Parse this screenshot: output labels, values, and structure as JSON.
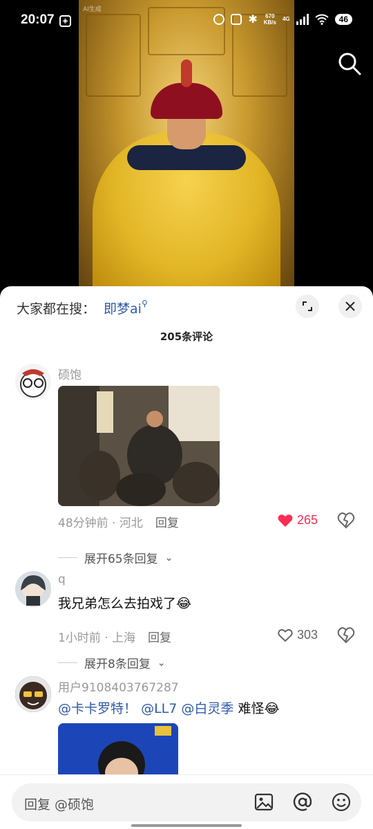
{
  "status_bar": {
    "time": "20:07",
    "ai_label": "AI生成",
    "net_speed_top": "670",
    "net_speed_bottom": "KB/s",
    "network_type": "4G",
    "battery": "46"
  },
  "sheet": {
    "search_prefix": "大家都在搜：",
    "search_term": "即梦ai",
    "comment_count": "205条评论"
  },
  "comments": [
    {
      "user": "硕饱",
      "time": "48分钟前 · 河北",
      "reply": "回复",
      "likes": "265",
      "liked": true,
      "expand": "展开65条回复"
    },
    {
      "user": "q",
      "text": "我兄弟怎么去拍戏了",
      "time": "1小时前 · 上海",
      "reply": "回复",
      "likes": "303",
      "liked": false,
      "expand": "展开8条回复"
    },
    {
      "user": "用户9108403767287",
      "mention1": "@卡卡罗特！",
      "mention2": "@LL7",
      "mention3": "@白灵季",
      "text_tail": "难怪"
    }
  ],
  "input": {
    "placeholder": "回复 @硕饱"
  },
  "colors": {
    "like_red": "#fe2c55",
    "link_blue": "#2f5aa8"
  }
}
